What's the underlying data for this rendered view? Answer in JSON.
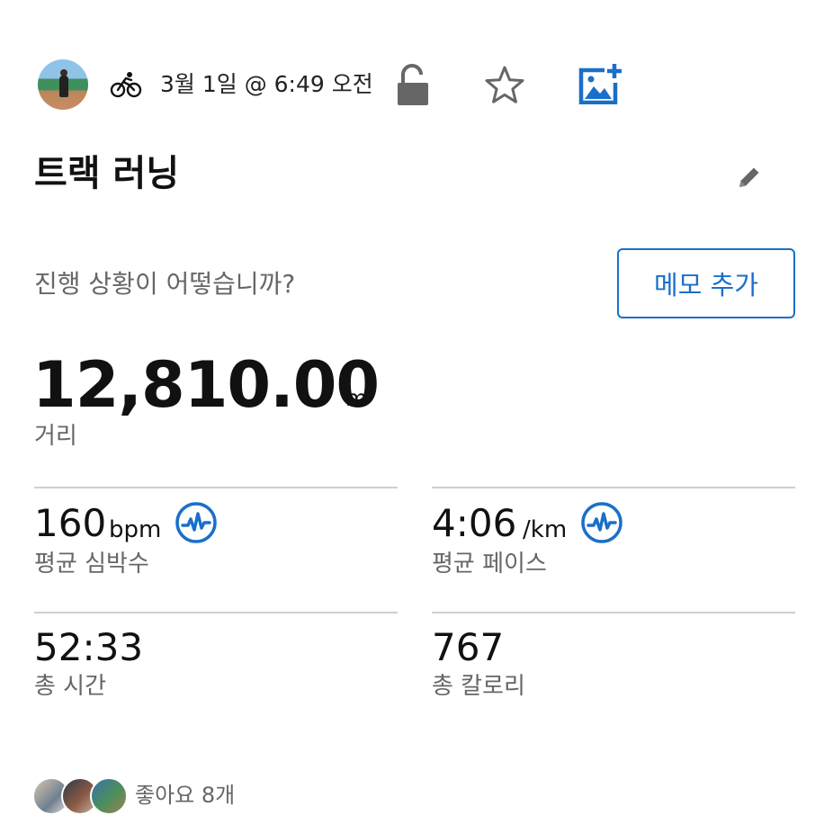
{
  "header": {
    "avatar": "profile-photo",
    "activity_icon": "cycling-runner-icon",
    "date_text": "3월 1일 @ 6:49 오전",
    "lock_icon": "unlock-icon",
    "star_icon": "star-outline-icon",
    "add_photo_icon": "add-photo-icon"
  },
  "activity": {
    "title": "트랙 러닝",
    "edit_icon": "pencil-icon"
  },
  "note": {
    "prompt": "진행 상황이 어떻습니까?",
    "memo_button": "메모 추가"
  },
  "distance": {
    "value": "12,810.00",
    "unit": "m",
    "label": "거리"
  },
  "stats": {
    "heart_rate": {
      "value": "160",
      "unit": "bpm",
      "label": "평균 심박수",
      "icon": "pulse-chart-icon"
    },
    "pace": {
      "value": "4:06",
      "unit": "/km",
      "label": "평균 페이스",
      "icon": "pulse-chart-icon"
    },
    "total_time": {
      "value": "52:33",
      "label": "총 시간"
    },
    "calories": {
      "value": "767",
      "label": "총 칼로리"
    }
  },
  "likes": {
    "text": "좋아요 8개"
  },
  "colors": {
    "accent": "#1a6fc9",
    "text_primary": "#111111",
    "text_secondary": "#666666",
    "divider": "#cfcfcf",
    "icon_gray": "#666666"
  }
}
